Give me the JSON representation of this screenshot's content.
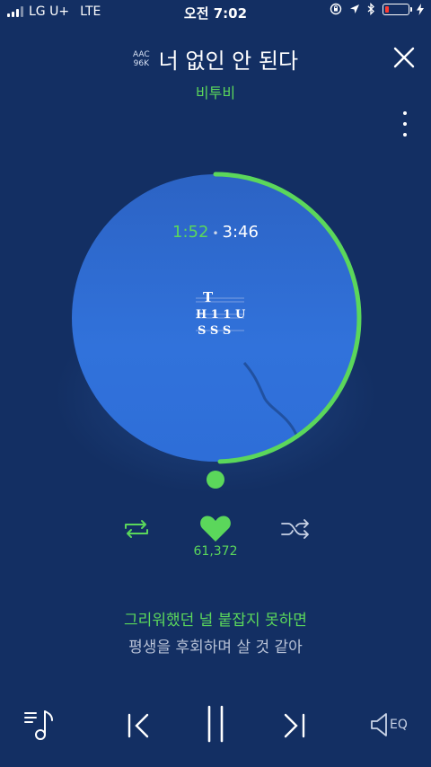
{
  "status": {
    "carrier": "LG U+",
    "network": "LTE",
    "time": "오전 7:02"
  },
  "header": {
    "quality_codec": "AAC",
    "quality_bitrate": "96K",
    "title": "너 없인 안 된다",
    "artist": "비투비"
  },
  "player": {
    "current_time": "1:52",
    "separator": "•",
    "total_time": "3:46",
    "progress_fraction": 0.495,
    "logo_line1": "T",
    "logo_line2": "H 1 1 U",
    "logo_line3": "S S S"
  },
  "actions": {
    "like_count": "61,372"
  },
  "lyrics": {
    "current": "그리워했던 널 붙잡지 못하면",
    "next": "평생을 후회하며 살 것 같아"
  },
  "bottom": {
    "eq_label": "EQ"
  },
  "colors": {
    "background": "#132f63",
    "accent_green": "#5bd75b",
    "disc_blue": "#3172db"
  }
}
